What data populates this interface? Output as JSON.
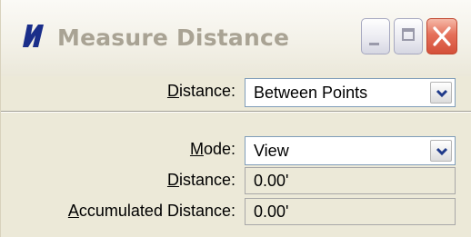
{
  "window": {
    "title": "Measure Distance",
    "icon": "microstation-logo-icon"
  },
  "distance_row": {
    "label_underlined": "D",
    "label_rest": "istance:",
    "value": "Between Points"
  },
  "mode_row": {
    "label_underlined": "M",
    "label_rest": "ode:",
    "value": "View"
  },
  "distance_output": {
    "label_underlined": "D",
    "label_rest": "istance:",
    "value": "0.00'"
  },
  "accumulated_output": {
    "label_underlined": "A",
    "label_rest": "ccumulated Distance:",
    "value": "0.00'"
  },
  "colors": {
    "accent": "#1a2e8a",
    "close": "#d4503a"
  }
}
